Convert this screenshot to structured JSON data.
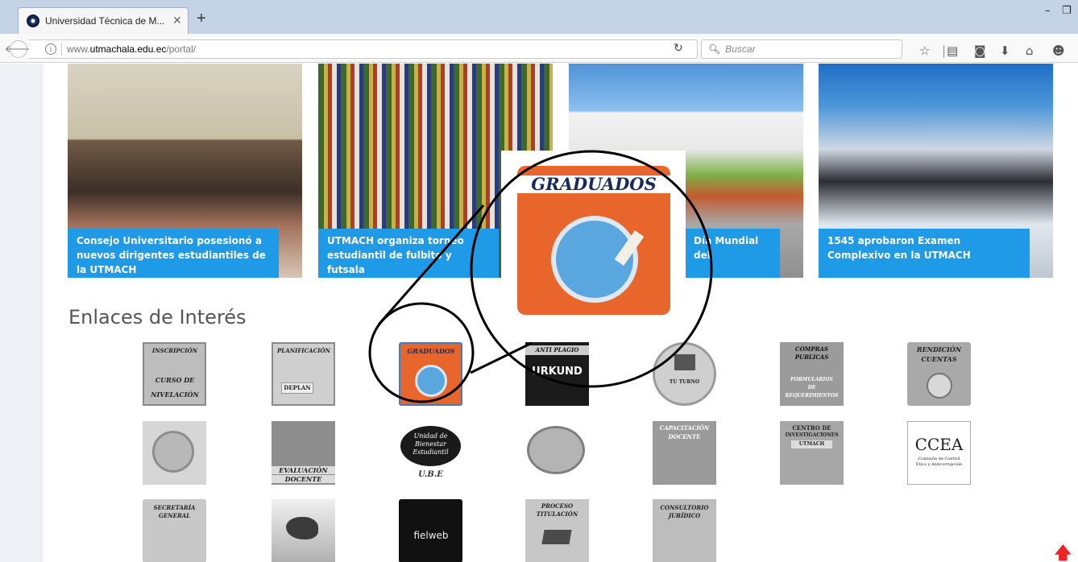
{
  "browser": {
    "tab_title": "Universidad Técnica de M...",
    "tab_close": "✕",
    "new_tab": "+",
    "url_prefix": "www.",
    "url_host": "utmachala.edu.ec",
    "url_path": "/portal/",
    "search_placeholder": "Buscar",
    "minimize": "–",
    "restore": "❐",
    "icons": [
      "star-icon",
      "reading-list-icon",
      "pocket-icon",
      "download-icon",
      "home-icon",
      "menu-icon"
    ]
  },
  "news": [
    {
      "caption": "Consejo Universitario posesionó a nuevos dirigentes estudiantiles de la UTMACH"
    },
    {
      "caption": "UTMACH organiza torneo estudiantil de fulbito y futsala"
    },
    {
      "caption": "Día Mundial del"
    },
    {
      "caption": "1545 aprobaron Examen Complexivo en la UTMACH"
    }
  ],
  "section_title": "Enlaces de Interés",
  "callout_label": "GRADUADOS",
  "links": {
    "row1": [
      {
        "name": "inscripcion",
        "lines": [
          "INSCRIPCIÓN",
          "CURSO DE",
          "NIVELACIÓN"
        ]
      },
      {
        "name": "planificacion",
        "lines": [
          "PLANIFICACIÓN",
          "DEPLAN"
        ]
      },
      {
        "name": "graduados",
        "lines": [
          "GRADUADOS"
        ]
      },
      {
        "name": "anti-plagio",
        "lines": [
          "ANTI PLAGIO",
          "URKUND"
        ]
      },
      {
        "name": "turno",
        "lines": [
          "TU TURNO"
        ]
      },
      {
        "name": "compras-publicas",
        "lines": [
          "COMPRAS",
          "PUBLICAS",
          "FORMULARIOS",
          "DE",
          "REQUERIMIENTOS"
        ]
      },
      {
        "name": "rendicion-cuentas",
        "lines": [
          "RENDICIÓN",
          "CUENTAS"
        ]
      }
    ],
    "row2": [
      {
        "name": "evaluacion-check",
        "lines": []
      },
      {
        "name": "evaluacion-docente",
        "lines": [
          "EVALUACIÓN",
          "DOCENTE"
        ]
      },
      {
        "name": "ube",
        "lines": [
          "Unidad de",
          "Bienestar",
          "Estudiantil",
          "U.B.E"
        ]
      },
      {
        "name": "buzon",
        "lines": []
      },
      {
        "name": "capacitacion-docente",
        "lines": [
          "CAPACITACIÓN",
          "DOCENTE"
        ]
      },
      {
        "name": "centro-investigaciones",
        "lines": [
          "CENTRO DE",
          "INVESTIGACIONES",
          "UTMACH"
        ]
      },
      {
        "name": "ccea",
        "lines": [
          "CCEA",
          "Comisión de Control",
          "Ético y Anticorrupción"
        ]
      }
    ],
    "row3": [
      {
        "name": "secretaria-general",
        "lines": [
          "SECRETARÍA",
          "GENERAL"
        ]
      },
      {
        "name": "bird",
        "lines": []
      },
      {
        "name": "fielweb",
        "lines": [
          "fielweb"
        ]
      },
      {
        "name": "proceso-titulacion",
        "lines": [
          "PROCESO",
          "TITULACIÓN"
        ]
      },
      {
        "name": "consultorio-juridico",
        "lines": [
          "CONSULTORIO",
          "JURÍDICO"
        ]
      }
    ]
  },
  "colors": {
    "caption_bg": "#1f9ae6",
    "graduados_orange": "#e8652c",
    "scroll_arrow": "#ee2222"
  }
}
